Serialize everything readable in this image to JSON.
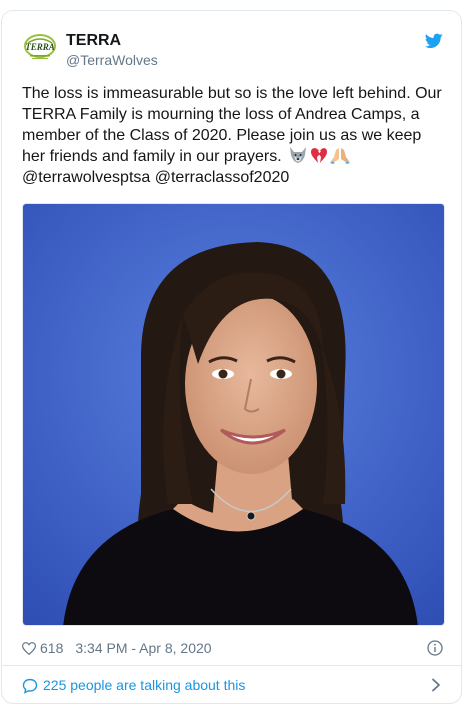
{
  "account": {
    "name": "TERRA",
    "handle": "@TerraWolves",
    "avatar_text": "TERRA"
  },
  "tweet": {
    "lines": [
      "The loss is immeasurable but so is the love left behind. Our",
      "TERRA Family is mourning the loss of Andrea Camps, a",
      "member of the Class of 2020. Please join us as we keep",
      "her friends and family in our prayers."
    ],
    "emojis": [
      "wolf-emoji",
      "broken-heart-emoji",
      "praying-hands-emoji"
    ],
    "mentions": "@terrawolvesptsa @terraclassof2020"
  },
  "meta": {
    "likes": "618",
    "timestamp": "3:34 PM - Apr 8, 2020"
  },
  "footer": {
    "talking": "225 people are talking about this"
  },
  "icons": {
    "twitter_bird": "twitter-bird-icon",
    "heart": "heart-icon",
    "info": "info-icon",
    "comment": "comment-bubble-icon",
    "chevron": "chevron-right-icon"
  },
  "colors": {
    "brand_blue": "#1da1f2",
    "link_blue": "#1b95e0",
    "secondary_text": "#657786",
    "border": "#e1e8ed",
    "photo_background": "#3f63c9"
  }
}
